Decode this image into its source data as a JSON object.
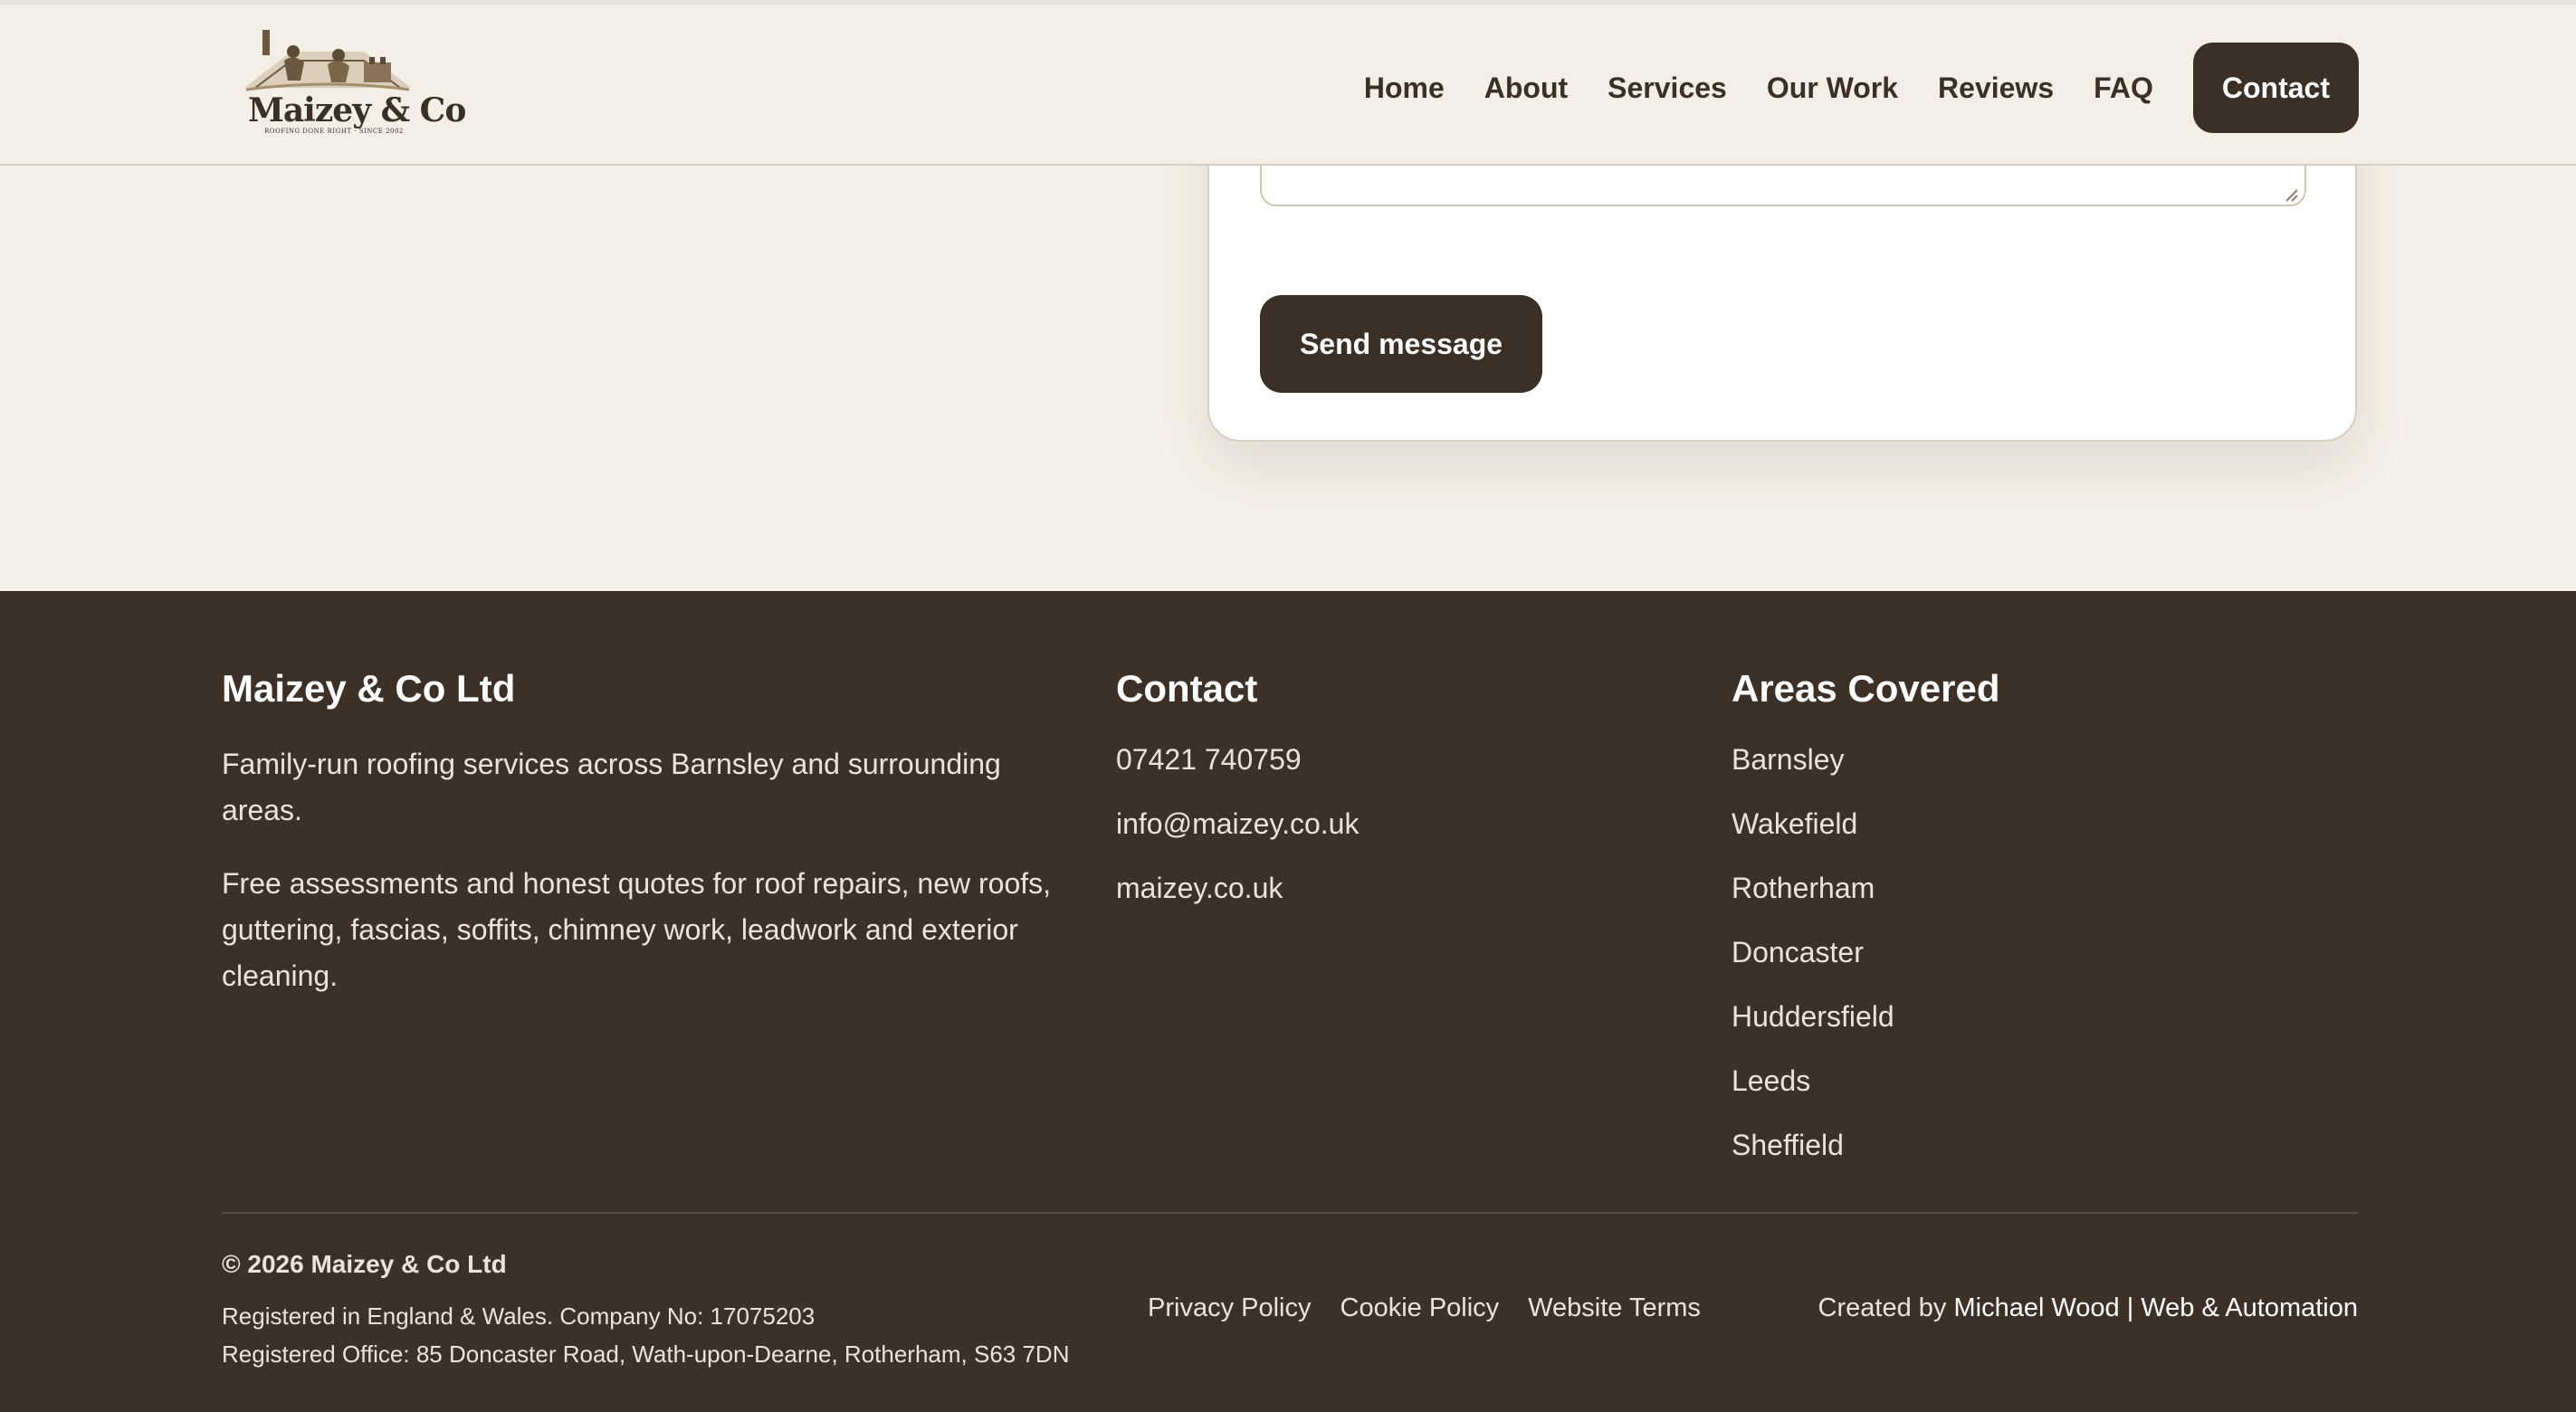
{
  "header": {
    "logo_text": "Maizey & Co",
    "logo_tagline": "ROOFING DONE RIGHT · SINCE 2002",
    "nav": [
      {
        "label": "Home"
      },
      {
        "label": "About"
      },
      {
        "label": "Services"
      },
      {
        "label": "Our Work"
      },
      {
        "label": "Reviews"
      },
      {
        "label": "FAQ"
      }
    ],
    "cta_label": "Contact"
  },
  "form": {
    "message_value": "",
    "send_label": "Send message"
  },
  "footer": {
    "about": {
      "title": "Maizey & Co Ltd",
      "paragraphs": [
        "Family-run roofing services across Barnsley and surrounding areas.",
        "Free assessments and honest quotes for roof repairs, new roofs, guttering, fascias, soffits, chimney work, leadwork and exterior cleaning."
      ]
    },
    "contact": {
      "title": "Contact",
      "phone": "07421 740759",
      "email": "info@maizey.co.uk",
      "website": "maizey.co.uk"
    },
    "areas": {
      "title": "Areas Covered",
      "items": [
        "Barnsley",
        "Wakefield",
        "Rotherham",
        "Doncaster",
        "Huddersfield",
        "Leeds",
        "Sheffield"
      ]
    },
    "copyright": "© 2026 Maizey & Co Ltd",
    "registration": "Registered in England & Wales. Company No: 17075203",
    "registered_office": "Registered Office: 85 Doncaster Road, Wath-upon-Dearne, Rotherham, S63 7DN",
    "legal_links": [
      {
        "label": "Privacy Policy"
      },
      {
        "label": "Cookie Policy"
      },
      {
        "label": "Website Terms"
      }
    ],
    "credit_prefix": "Created by",
    "credit_link": "Michael Wood | Web & Automation"
  },
  "colors": {
    "page_bg": "#f5f0e7",
    "brand_dark": "#3d3026",
    "text_light": "#ece4d8"
  }
}
